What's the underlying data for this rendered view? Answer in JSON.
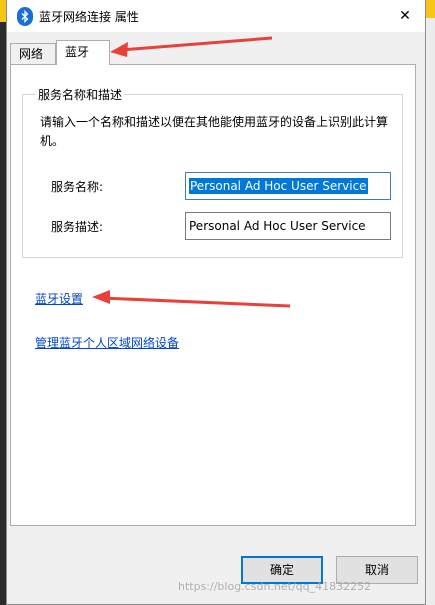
{
  "window": {
    "title": "蓝牙网络连接 属性",
    "close_glyph": "✕"
  },
  "tabs": [
    {
      "label": "网络",
      "selected": false
    },
    {
      "label": "蓝牙",
      "selected": true
    }
  ],
  "group": {
    "title": "服务名称和描述",
    "description": "请输入一个名称和描述以便在其他能使用蓝牙的设备上识别此计算机。",
    "service_name_label": "服务名称:",
    "service_name_value": "Personal Ad Hoc User Service",
    "service_desc_label": "服务描述:",
    "service_desc_value": "Personal Ad Hoc User Service"
  },
  "links": {
    "bt_settings": "蓝牙设置",
    "pan_devices": "管理蓝牙个人区域网络设备"
  },
  "buttons": {
    "ok": "确定",
    "cancel": "取消"
  },
  "watermark": "https://blog.csdn.net/qq_41832252",
  "colors": {
    "link": "#0046c8",
    "selection": "#0078d7",
    "annotation_arrow": "#e8413a",
    "bluetooth_icon": "#1a6fd6"
  }
}
